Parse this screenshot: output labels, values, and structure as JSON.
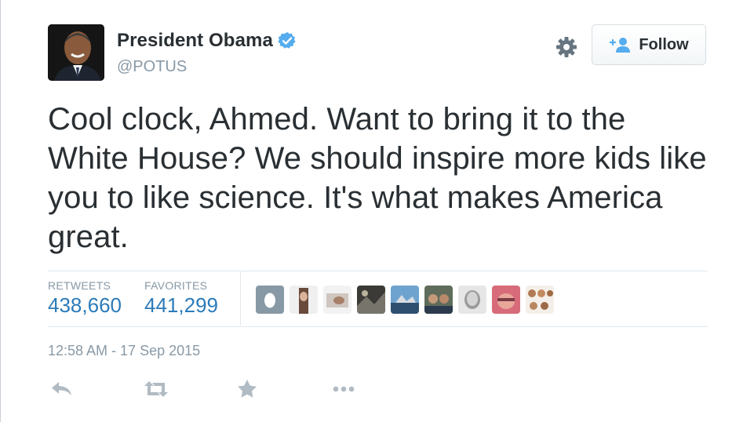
{
  "user": {
    "display_name": "President Obama",
    "handle": "@POTUS",
    "verified": true
  },
  "header": {
    "settings_icon": "gear-icon",
    "follow_label": "Follow",
    "follow_icon": "add-user-icon"
  },
  "tweet": {
    "text": "Cool clock, Ahmed. Want to bring it to the White House? We should inspire more kids like you to like science. It's what makes America great.",
    "timestamp": "12:58 AM - 17 Sep 2015"
  },
  "stats": {
    "retweets_label": "RETWEETS",
    "retweets_value": "438,660",
    "favorites_label": "FAVORITES",
    "favorites_value": "441,299"
  },
  "favoriters": [
    "egg-avatar",
    "avatar-2",
    "avatar-3",
    "avatar-4",
    "avatar-5",
    "avatar-6",
    "avatar-7",
    "avatar-8",
    "avatar-9"
  ],
  "actions": [
    "reply-icon",
    "retweet-icon",
    "favorite-icon",
    "more-icon"
  ],
  "colors": {
    "link_blue": "#2b7bb9",
    "muted": "#8899a6",
    "text": "#292f33",
    "verified": "#55acee"
  }
}
